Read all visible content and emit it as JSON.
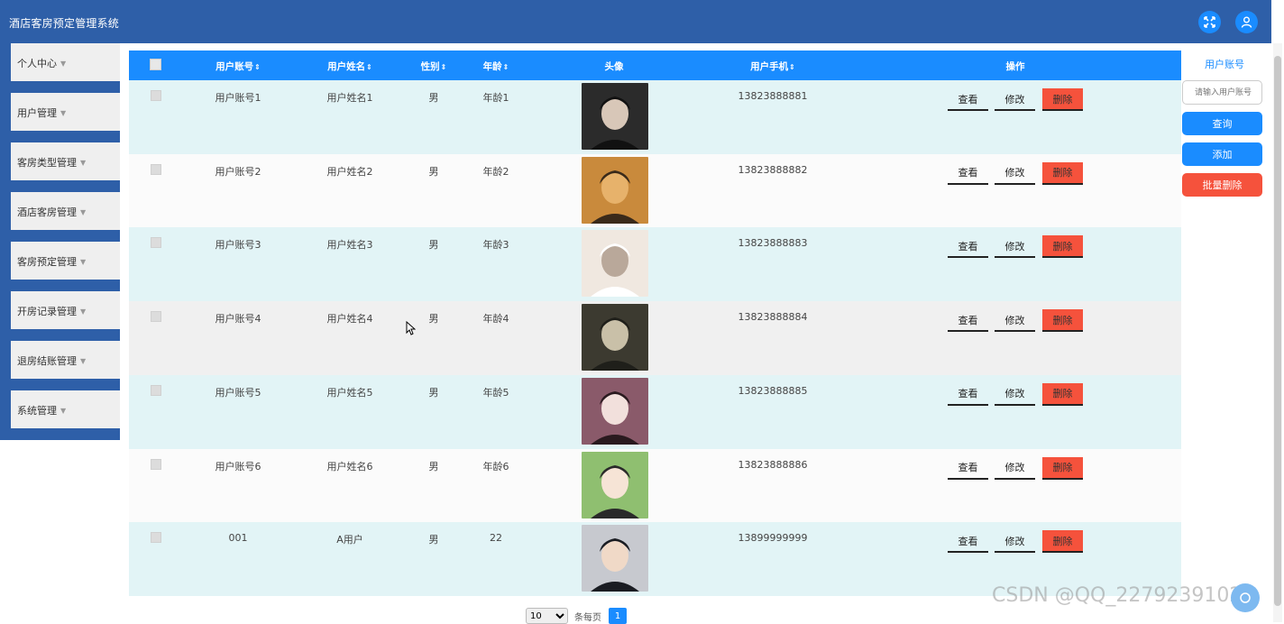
{
  "app": {
    "title": "酒店客房预定管理系统"
  },
  "header": {
    "fullscreen_icon": "expand-icon",
    "user_icon": "user-icon"
  },
  "sidebar": {
    "items": [
      {
        "label": "个人中心"
      },
      {
        "label": "用户管理"
      },
      {
        "label": "客房类型管理"
      },
      {
        "label": "酒店客房管理"
      },
      {
        "label": "客房预定管理"
      },
      {
        "label": "开房记录管理"
      },
      {
        "label": "退房结账管理"
      },
      {
        "label": "系统管理"
      }
    ]
  },
  "table": {
    "headers": {
      "account": "用户账号",
      "name": "用户姓名",
      "gender": "性别",
      "age": "年龄",
      "avatar": "头像",
      "phone": "用户手机",
      "actions": "操作"
    },
    "sort_glyph": "⇕",
    "rows": [
      {
        "account": "用户账号1",
        "name": "用户姓名1",
        "gender": "男",
        "age": "年龄1",
        "phone": "13823888881",
        "view": "查看",
        "edit": "修改",
        "delete": "删除"
      },
      {
        "account": "用户账号2",
        "name": "用户姓名2",
        "gender": "男",
        "age": "年龄2",
        "phone": "13823888882",
        "view": "查看",
        "edit": "修改",
        "delete": "删除"
      },
      {
        "account": "用户账号3",
        "name": "用户姓名3",
        "gender": "男",
        "age": "年龄3",
        "phone": "13823888883",
        "view": "查看",
        "edit": "修改",
        "delete": "删除"
      },
      {
        "account": "用户账号4",
        "name": "用户姓名4",
        "gender": "男",
        "age": "年龄4",
        "phone": "13823888884",
        "view": "查看",
        "edit": "修改",
        "delete": "删除"
      },
      {
        "account": "用户账号5",
        "name": "用户姓名5",
        "gender": "男",
        "age": "年龄5",
        "phone": "13823888885",
        "view": "查看",
        "edit": "修改",
        "delete": "删除"
      },
      {
        "account": "用户账号6",
        "name": "用户姓名6",
        "gender": "男",
        "age": "年龄6",
        "phone": "13823888886",
        "view": "查看",
        "edit": "修改",
        "delete": "删除"
      },
      {
        "account": "001",
        "name": "A用户",
        "gender": "男",
        "age": "22",
        "phone": "13899999999",
        "view": "查看",
        "edit": "修改",
        "delete": "删除"
      }
    ]
  },
  "search": {
    "label": "用户账号",
    "placeholder": "请输入用户账号",
    "query_button": "查询",
    "add_button": "添加",
    "batch_delete_button": "批量删除"
  },
  "pagination": {
    "page_size": "10",
    "per_page_label": "条每页",
    "current_page": "1"
  },
  "watermark": "CSDN @QQ_2279239102",
  "colors": {
    "header": "#2e5fa8",
    "accent": "#1a8cff",
    "danger": "#f5523c",
    "row_alt": "#e2f4f6"
  }
}
